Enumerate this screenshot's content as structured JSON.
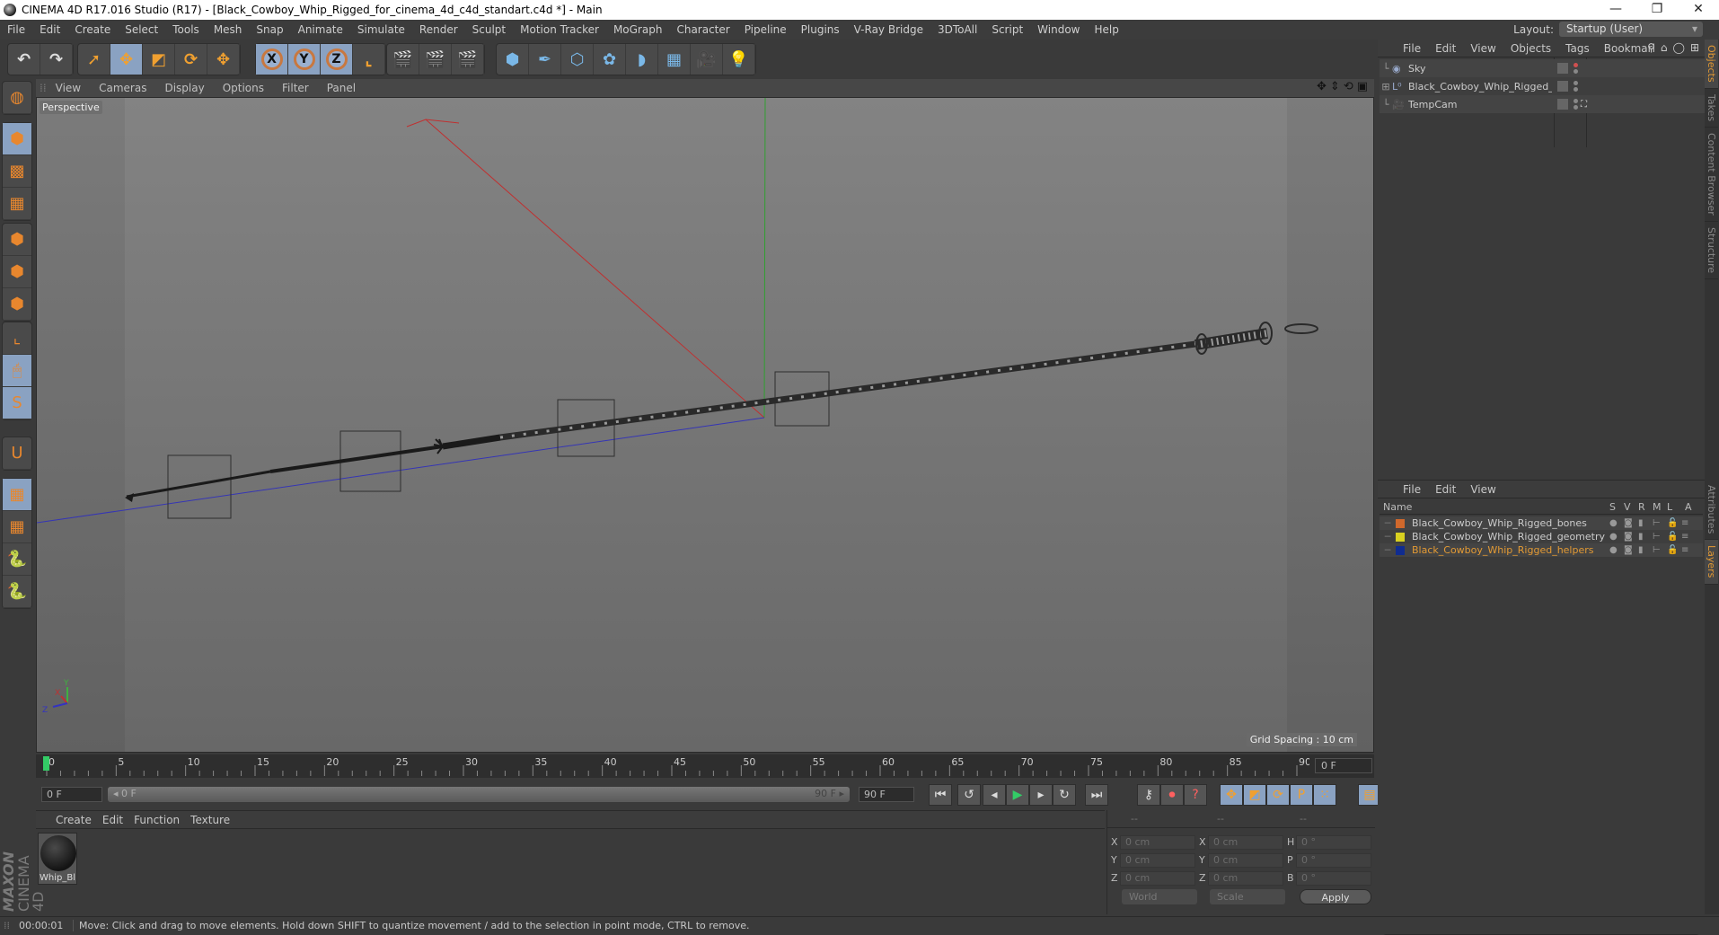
{
  "window": {
    "title": "CINEMA 4D R17.016 Studio (R17) - [Black_Cowboy_Whip_Rigged_for_cinema_4d_c4d_standart.c4d *] - Main",
    "controls": [
      "minimize",
      "restore",
      "close"
    ]
  },
  "menubar": {
    "items": [
      "File",
      "Edit",
      "Create",
      "Select",
      "Tools",
      "Mesh",
      "Snap",
      "Animate",
      "Simulate",
      "Render",
      "Sculpt",
      "Motion Tracker",
      "MoGraph",
      "Character",
      "Pipeline",
      "Plugins",
      "V-Ray Bridge",
      "3DToAll",
      "Script",
      "Window",
      "Help"
    ],
    "layout_label": "Layout:",
    "layout_value": "Startup (User)"
  },
  "toolbar": {
    "groups": [
      {
        "name": "history",
        "buttons": [
          {
            "icon": "undo-icon",
            "glyph": "↶"
          },
          {
            "icon": "redo-icon",
            "glyph": "↷"
          }
        ]
      },
      {
        "name": "tools",
        "buttons": [
          {
            "icon": "select-arrow-icon",
            "glyph": "➚",
            "active": false
          },
          {
            "icon": "move-icon",
            "glyph": "✥",
            "active": true
          },
          {
            "icon": "scale-icon",
            "glyph": "◩",
            "active": false
          },
          {
            "icon": "rotate-icon",
            "glyph": "⟳",
            "active": false
          },
          {
            "icon": "live-selection-move-icon",
            "glyph": "✥",
            "active": false
          }
        ]
      },
      {
        "name": "axes",
        "buttons": [
          {
            "icon": "x-axis-lock-icon",
            "glyph": "X",
            "active": true
          },
          {
            "icon": "y-axis-lock-icon",
            "glyph": "Y",
            "active": true
          },
          {
            "icon": "z-axis-lock-icon",
            "glyph": "Z",
            "active": true
          },
          {
            "icon": "coordinate-system-icon",
            "glyph": "⌞",
            "active": false
          }
        ]
      },
      {
        "name": "render",
        "buttons": [
          {
            "icon": "render-view-icon",
            "glyph": "🎬"
          },
          {
            "icon": "render-picture-viewer-icon",
            "glyph": "🎬"
          },
          {
            "icon": "render-settings-icon",
            "glyph": "🎬"
          }
        ]
      },
      {
        "name": "create",
        "buttons": [
          {
            "icon": "cube-primitive-icon",
            "glyph": "⬢"
          },
          {
            "icon": "pen-spline-icon",
            "glyph": "✒"
          },
          {
            "icon": "subdivision-nurbs-icon",
            "glyph": "⬡"
          },
          {
            "icon": "mograph-cloner-icon",
            "glyph": "✿"
          },
          {
            "icon": "deformer-bend-icon",
            "glyph": "◗"
          },
          {
            "icon": "floor-scene-icon",
            "glyph": "▦"
          },
          {
            "icon": "camera-icon",
            "glyph": "🎥"
          },
          {
            "icon": "light-bulb-icon",
            "glyph": "💡"
          }
        ]
      }
    ]
  },
  "left_tools": [
    {
      "icon": "make-editable-icon",
      "glyph": "◍",
      "active": false,
      "group": 0
    },
    {
      "icon": "model-mode-icon",
      "glyph": "⬢",
      "active": true,
      "group": 1
    },
    {
      "icon": "texture-mode-icon",
      "glyph": "▩",
      "active": false,
      "group": 1
    },
    {
      "icon": "workplane-mode-icon",
      "glyph": "▦",
      "active": false,
      "group": 1
    },
    {
      "icon": "points-mode-icon",
      "glyph": "⬢",
      "active": false,
      "group": 2
    },
    {
      "icon": "edges-mode-icon",
      "glyph": "⬢",
      "active": false,
      "group": 2
    },
    {
      "icon": "polygons-mode-icon",
      "glyph": "⬢",
      "active": false,
      "group": 2
    },
    {
      "icon": "axis-mode-icon",
      "glyph": "⌞",
      "active": false,
      "group": 3
    },
    {
      "icon": "tweak-mode-icon",
      "glyph": "🖱",
      "active": true,
      "group": 3
    },
    {
      "icon": "solo-mode-icon",
      "glyph": "S",
      "active": true,
      "group": 3
    },
    {
      "icon": "snap-magnet-icon",
      "glyph": "U",
      "active": false,
      "group": 4
    },
    {
      "icon": "workplane-lock-icon",
      "glyph": "▦",
      "active": true,
      "group": 5
    },
    {
      "icon": "workplane-align-icon",
      "glyph": "▦",
      "active": false,
      "group": 5
    },
    {
      "icon": "python-script-icon",
      "glyph": "🐍",
      "active": false,
      "group": 5
    },
    {
      "icon": "python-script-2-icon",
      "glyph": "🐍",
      "active": false,
      "group": 5
    }
  ],
  "viewport": {
    "menu": [
      "View",
      "Cameras",
      "Display",
      "Options",
      "Filter",
      "Panel"
    ],
    "camera_label": "Perspective",
    "grid_spacing": "Grid Spacing : 10 cm",
    "nav_icons": [
      "move-view-icon",
      "dolly-view-icon",
      "rotate-view-icon",
      "toggle-layout-icon"
    ],
    "axis_labels": {
      "x": "X",
      "y": "Y",
      "z": "Z"
    },
    "colors": {
      "x_axis": "#c03030",
      "y_axis": "#30a030",
      "z_axis": "#3030b0",
      "wire": "#1e1e1e"
    }
  },
  "timeline": {
    "ticks": [
      "0",
      "5",
      "10",
      "15",
      "20",
      "25",
      "30",
      "35",
      "40",
      "45",
      "50",
      "55",
      "60",
      "65",
      "70",
      "75",
      "80",
      "85",
      "90"
    ],
    "range_min": 0,
    "range_max": 90,
    "current_frame": 0,
    "current_frame_field": "0 F",
    "playhead_color": "#33cc66"
  },
  "transport": {
    "start_field": "0 F",
    "range_start": "◂ 0 F",
    "range_end": "90 F ▸",
    "end_field": "90 F",
    "buttons": [
      {
        "icon": "goto-start-icon",
        "glyph": "⏮"
      },
      {
        "icon": "prev-key-icon",
        "glyph": "↺"
      },
      {
        "icon": "prev-frame-icon",
        "glyph": "◂"
      },
      {
        "icon": "play-icon",
        "glyph": "▶"
      },
      {
        "icon": "next-frame-icon",
        "glyph": "▸"
      },
      {
        "icon": "next-key-icon",
        "glyph": "↻"
      },
      {
        "icon": "goto-end-icon",
        "glyph": "⏭"
      },
      {
        "icon": "keyframe-record-disabled-icon",
        "glyph": "⚷"
      },
      {
        "icon": "autokey-record-icon",
        "glyph": "⏺"
      },
      {
        "icon": "keyframe-selection-icon",
        "glyph": "?"
      },
      {
        "icon": "key-position-icon",
        "glyph": "✥"
      },
      {
        "icon": "key-scale-icon",
        "glyph": "◩"
      },
      {
        "icon": "key-rotation-icon",
        "glyph": "⟳"
      },
      {
        "icon": "key-parameter-icon",
        "glyph": "P"
      },
      {
        "icon": "key-point-level-icon",
        "glyph": "⁙"
      },
      {
        "icon": "timeline-window-icon",
        "glyph": "▤"
      }
    ]
  },
  "material_panel": {
    "menu": [
      "Create",
      "Edit",
      "Function",
      "Texture"
    ],
    "materials": [
      {
        "name": "Whip_Bl"
      }
    ]
  },
  "coordinates_panel": {
    "headers": [
      "--",
      "--",
      "--"
    ],
    "rows": [
      {
        "pos_label": "X",
        "pos": "0 cm",
        "size_label": "X",
        "size": "0 cm",
        "rot_label": "H",
        "rot": "0 °"
      },
      {
        "pos_label": "Y",
        "pos": "0 cm",
        "size_label": "Y",
        "size": "0 cm",
        "rot_label": "P",
        "rot": "0 °"
      },
      {
        "pos_label": "Z",
        "pos": "0 cm",
        "size_label": "Z",
        "size": "0 cm",
        "rot_label": "B",
        "rot": "0 °"
      }
    ],
    "coord_system": "World",
    "transform_mode": "Scale",
    "apply_label": "Apply"
  },
  "objects_panel": {
    "menu": [
      "File",
      "Edit",
      "View",
      "Objects",
      "Tags",
      "Bookmarl"
    ],
    "tool_icons": [
      "search-icon",
      "home-icon",
      "visibility-icon",
      "new-panel-icon"
    ],
    "objects": [
      {
        "name": "Sky",
        "icon": "sky-sphere-icon",
        "expandable": false,
        "dot_color": "#d05050",
        "tag": ""
      },
      {
        "name": "Black_Cowboy_Whip_Rigged_",
        "icon": "null-object-icon",
        "expandable": true,
        "dot_color": "#888888",
        "tag": ""
      },
      {
        "name": "TempCam",
        "icon": "camera-object-icon",
        "expandable": false,
        "dot_color": "#888888",
        "tag": "target-tag-icon"
      }
    ]
  },
  "layers_panel": {
    "menu": [
      "File",
      "Edit",
      "View"
    ],
    "columns": [
      "Name",
      "S",
      "V",
      "R",
      "M",
      "L",
      "A"
    ],
    "layers": [
      {
        "name": "Black_Cowboy_Whip_Rigged_bones",
        "color": "#d0682c",
        "highlight": false
      },
      {
        "name": "Black_Cowboy_Whip_Rigged_geometry",
        "color": "#d8d020",
        "highlight": false
      },
      {
        "name": "Black_Cowboy_Whip_Rigged_helpers",
        "color": "#102c90",
        "highlight": true
      }
    ],
    "highlight_color": "#e39a34"
  },
  "side_tabs_top": [
    {
      "label": "Objects",
      "active": true
    },
    {
      "label": "Takes",
      "active": false
    },
    {
      "label": "Content Browser",
      "active": false
    },
    {
      "label": "Structure",
      "active": false
    }
  ],
  "side_tabs_bottom": [
    {
      "label": "Attributes",
      "active": false
    },
    {
      "label": "Layers",
      "active": true
    }
  ],
  "branding": {
    "maxon": "MAXON",
    "product": "CINEMA 4D"
  },
  "statusbar": {
    "time": "00:00:01",
    "message": "Move: Click and drag to move elements. Hold down SHIFT to quantize movement / add to the selection in point mode, CTRL to remove."
  }
}
